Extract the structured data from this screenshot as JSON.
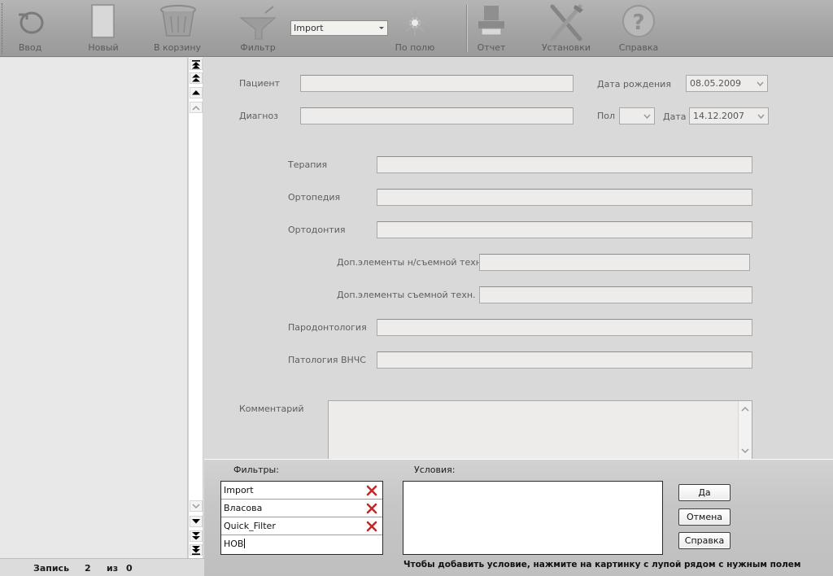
{
  "toolbar": {
    "buttons": {
      "enter": "Ввод",
      "new": "Новый",
      "trash": "В корзину",
      "filter": "Фильтр",
      "by_field": "По полю",
      "report": "Отчет",
      "settings": "Установки",
      "help": "Справка"
    },
    "import_select": "Import"
  },
  "record_status": {
    "label": "Запись",
    "current": "2",
    "of_label": "из",
    "total": "0"
  },
  "form": {
    "patient_label": "Пациент",
    "patient_value": "",
    "birthdate_label": "Дата рождения",
    "birthdate_value": "08.05.2009",
    "diagnosis_label": "Диагноз",
    "diagnosis_value": "",
    "sex_label": "Пол",
    "sex_value": "",
    "date_label": "Дата",
    "date_value": "14.12.2007",
    "therapy_label": "Терапия",
    "orthopedics_label": "Ортопедия",
    "orthodontics_label": "Ортодонтия",
    "fixed_extra_label": "Доп.элементы н/съемной техн.",
    "removable_extra_label": "Доп.элементы съемной техн.",
    "periodontology_label": "Пародонтология",
    "tmj_label": "Патология ВНЧС",
    "comment_label": "Комментарий"
  },
  "filter_panel": {
    "filters_title": "Фильтры:",
    "conditions_title": "Условия:",
    "filters": [
      {
        "name": "Import"
      },
      {
        "name": "Власова"
      },
      {
        "name": "Quick_Filter"
      }
    ],
    "new_filter_value": "НОВ",
    "ok_button": "Да",
    "cancel_button": "Отмена",
    "help_button": "Справка",
    "hint": "Чтобы добавить условие, нажмите на картинку с лупой рядом с нужным полем"
  },
  "colors": {
    "delete_icon": "#c62828",
    "toolbar_bg": "#a8a8a8",
    "field_bg": "#eeecea"
  }
}
